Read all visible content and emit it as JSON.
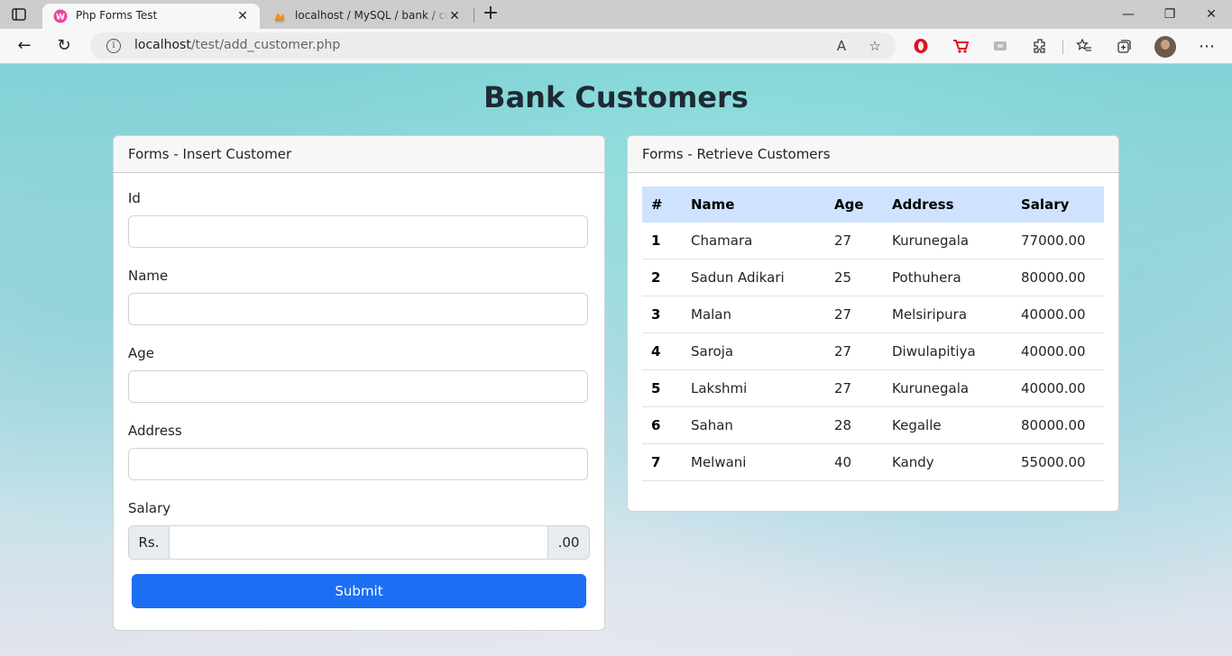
{
  "browser": {
    "tabs": [
      {
        "title": "Php Forms Test",
        "active": true
      },
      {
        "title": "localhost / MySQL / bank / customer",
        "active": false
      }
    ],
    "url_host": "localhost",
    "url_path": "/test/add_customer.php"
  },
  "page": {
    "title": "Bank Customers"
  },
  "insert_form": {
    "header": "Forms - Insert Customer",
    "fields": {
      "id_label": "Id",
      "name_label": "Name",
      "age_label": "Age",
      "address_label": "Address",
      "salary_label": "Salary"
    },
    "salary_prefix": "Rs.",
    "salary_suffix": ".00",
    "submit_label": "Submit"
  },
  "retrieve": {
    "header": "Forms - Retrieve Customers",
    "columns": [
      "#",
      "Name",
      "Age",
      "Address",
      "Salary"
    ],
    "rows": [
      [
        "1",
        "Chamara",
        "27",
        "Kurunegala",
        "77000.00"
      ],
      [
        "2",
        "Sadun Adikari",
        "25",
        "Pothuhera",
        "80000.00"
      ],
      [
        "3",
        "Malan",
        "27",
        "Melsiripura",
        "40000.00"
      ],
      [
        "4",
        "Saroja",
        "27",
        "Diwulapitiya",
        "40000.00"
      ],
      [
        "5",
        "Lakshmi",
        "27",
        "Kurunegala",
        "40000.00"
      ],
      [
        "6",
        "Sahan",
        "28",
        "Kegalle",
        "80000.00"
      ],
      [
        "7",
        "Melwani",
        "40",
        "Kandy",
        "55000.00"
      ]
    ]
  },
  "colors": {
    "primary": "#1c6ef2",
    "table_head": "#cfe2ff",
    "background": "#a6dadf"
  }
}
